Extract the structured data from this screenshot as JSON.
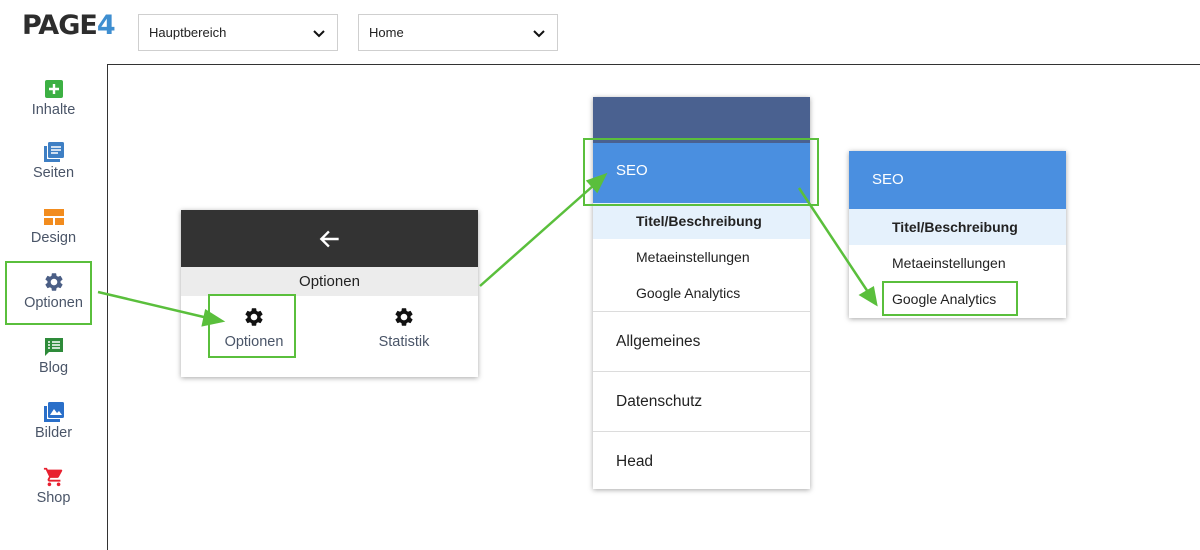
{
  "logo": {
    "part1": "PAGE",
    "part2": "4"
  },
  "dropdowns": {
    "bereich": {
      "value": "Hauptbereich",
      "icon": "chevron-down-icon"
    },
    "seite": {
      "value": "Home",
      "icon": "chevron-down-icon"
    }
  },
  "sidebar": {
    "items": [
      {
        "label": "Inhalte",
        "icon": "plus-box-icon",
        "color": "#3cb043"
      },
      {
        "label": "Seiten",
        "icon": "pages-icon",
        "color": "#3e7fc4"
      },
      {
        "label": "Design",
        "icon": "layout-icon",
        "color": "#f28c1e"
      },
      {
        "label": "Optionen",
        "icon": "gear-icon",
        "color": "#4a5e85"
      },
      {
        "label": "Blog",
        "icon": "blog-icon",
        "color": "#2e8b3a"
      },
      {
        "label": "Bilder",
        "icon": "images-icon",
        "color": "#2a6fc9"
      },
      {
        "label": "Shop",
        "icon": "cart-icon",
        "color": "#e8202f"
      }
    ]
  },
  "panel1": {
    "back_icon": "arrow-left-icon",
    "title": "Optionen",
    "options": [
      {
        "label": "Optionen",
        "icon": "gear-icon"
      },
      {
        "label": "Statistik",
        "icon": "gear-icon"
      }
    ]
  },
  "panel2": {
    "seo_label": "SEO",
    "sub_items": [
      "Titel/Beschreibung",
      "Metaeinstellungen",
      "Google Analytics"
    ],
    "sections": [
      "Allgemeines",
      "Datenschutz",
      "Head"
    ]
  },
  "panel3": {
    "seo_label": "SEO",
    "sub_items": [
      "Titel/Beschreibung",
      "Metaeinstellungen",
      "Google Analytics"
    ]
  },
  "colors": {
    "accent_blue": "#4a8fe0",
    "header_dark": "#333333",
    "header_navy": "#4a6190",
    "highlight_green": "#5abf3c",
    "active_bg": "#e5f1fc"
  }
}
